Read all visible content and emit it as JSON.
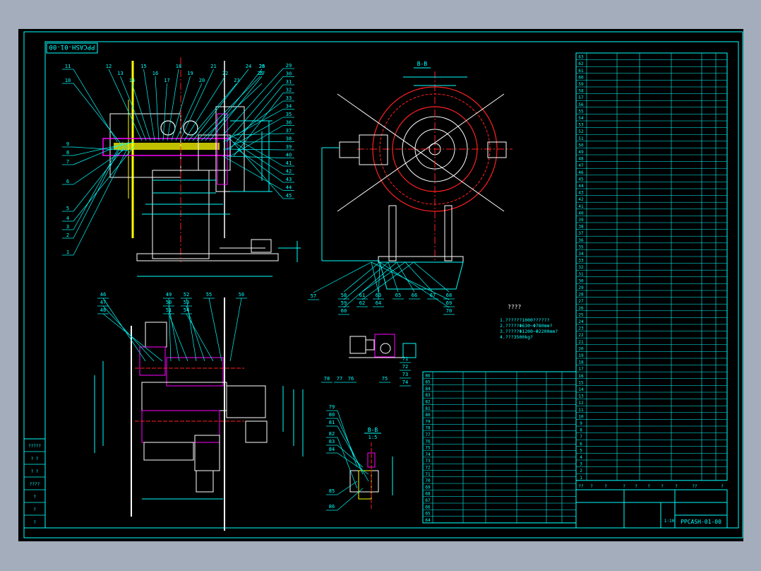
{
  "drawing": {
    "number": "PPCASH-01-00",
    "scale": "1:10",
    "section_label": "B-B",
    "section_scale": "1:5",
    "notes_title": "????",
    "notes": [
      "1.??????1000??????",
      "2.?????Φ630~Φ780mm?",
      "3.?????Φ1200~Φ2200mm?",
      "4.???3500kg?"
    ],
    "left_table_labels": [
      "?????",
      "? ?",
      "? ?",
      "????",
      "?",
      "?",
      "?"
    ],
    "title_row_labels": [
      "??",
      "?",
      "?",
      "?",
      "?",
      "?",
      "?",
      "?",
      "??",
      "?"
    ]
  },
  "callouts": {
    "front_left": [
      "11",
      "10",
      "9",
      "8",
      "7",
      "6",
      "5",
      "4",
      "3",
      "2",
      "1"
    ],
    "front_top": [
      "12",
      "13",
      "14",
      "15",
      "16",
      "17",
      "18",
      "19",
      "20",
      "21",
      "22",
      "23",
      "24",
      "25",
      "26",
      "27",
      "28"
    ],
    "front_right": [
      "29",
      "30",
      "31",
      "32",
      "33",
      "34",
      "35",
      "36",
      "37",
      "38",
      "39",
      "40",
      "41",
      "42",
      "43",
      "44",
      "45"
    ],
    "side_bottom": [
      "57",
      "58",
      "59",
      "60",
      "61",
      "62",
      "63",
      "64",
      "65",
      "66",
      "67",
      "68",
      "69",
      "70"
    ],
    "plan_top": [
      "46",
      "47",
      "48",
      "49",
      "50",
      "51",
      "52",
      "53",
      "54",
      "55",
      "56"
    ],
    "small_view": [
      "78",
      "77",
      "76",
      "75",
      "71",
      "72",
      "73",
      "74"
    ],
    "section_view": [
      "79",
      "80",
      "81",
      "82",
      "83",
      "84",
      "85",
      "86"
    ]
  },
  "parts_list": {
    "right_numbers": [
      "63",
      "62",
      "61",
      "60",
      "59",
      "58",
      "57",
      "56",
      "55",
      "54",
      "53",
      "52",
      "51",
      "50",
      "49",
      "48",
      "47",
      "46",
      "45",
      "44",
      "43",
      "42",
      "41",
      "40",
      "39",
      "38",
      "37",
      "36",
      "35",
      "34",
      "33",
      "32",
      "31",
      "30",
      "29",
      "28",
      "27",
      "26",
      "25",
      "24",
      "23",
      "22",
      "21",
      "20",
      "19",
      "18",
      "17",
      "16",
      "15",
      "14",
      "13",
      "12",
      "11",
      "10",
      "9",
      "8",
      "7",
      "6",
      "5",
      "4",
      "3",
      "2",
      "1"
    ],
    "bottom_numbers": [
      "86",
      "85",
      "84",
      "83",
      "82",
      "81",
      "80",
      "79",
      "78",
      "77",
      "76",
      "75",
      "74",
      "73",
      "72",
      "71",
      "70",
      "69",
      "68",
      "67",
      "66",
      "65",
      "64"
    ]
  },
  "colors": {
    "background": "#000000",
    "line": "#00ffff",
    "red": "#ff2020",
    "yellow": "#ffff00",
    "magenta": "#ff00ff",
    "white": "#ffffff",
    "green": "#00ff00"
  }
}
